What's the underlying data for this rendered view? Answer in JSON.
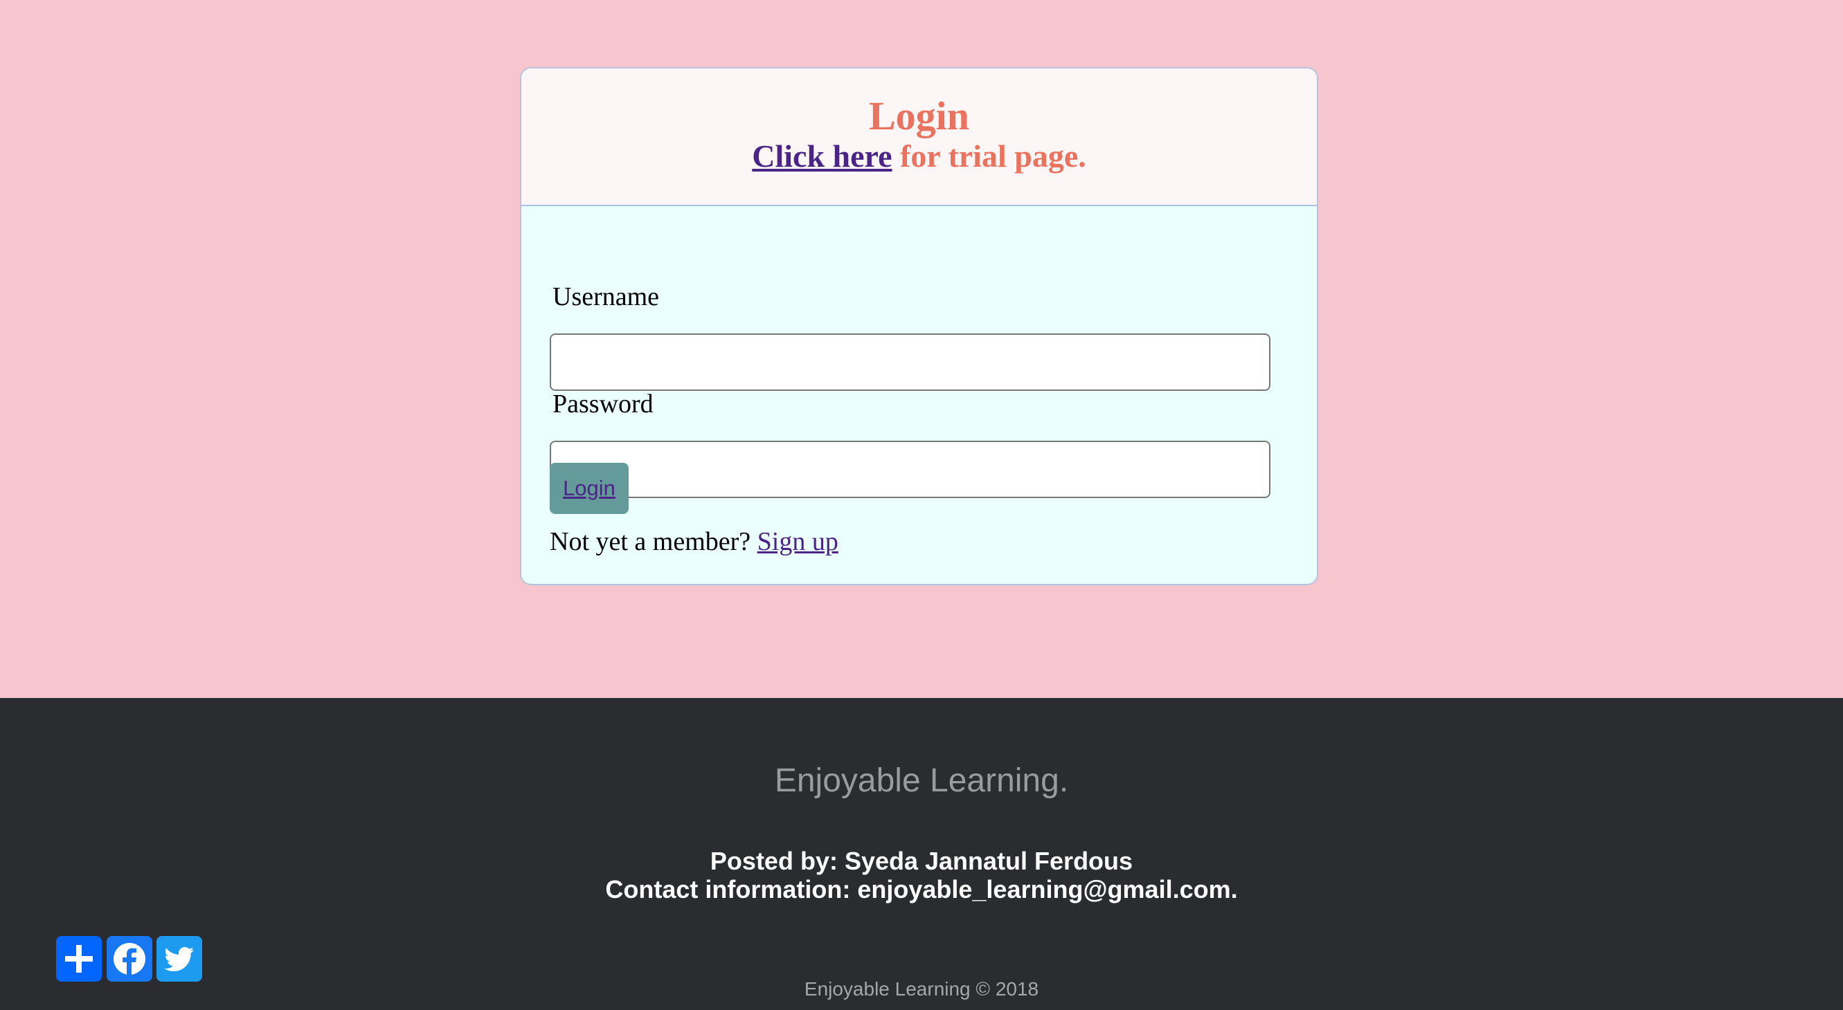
{
  "login_card": {
    "title": "Login",
    "subtitle_link": "Click here",
    "subtitle_rest": " for trial page.",
    "username_label": "Username",
    "username_value": "",
    "password_label": "Password",
    "password_value": "",
    "login_button": "Login",
    "signup_prompt": "Not yet a member? ",
    "signup_link": "Sign up"
  },
  "footer": {
    "tagline": "Enjoyable Learning.",
    "posted_by": "Posted by: Syeda Jannatul Ferdous",
    "contact": "Contact information: enjoyable_learning@gmail.com.",
    "copyright": "Enjoyable Learning © 2018"
  },
  "share": {
    "icons": [
      "plus-icon",
      "facebook-icon",
      "twitter-icon"
    ]
  },
  "colors": {
    "page_background": "#f7c5ce",
    "card_header": "#fdf6f6",
    "card_body": "#ebffff",
    "title": "#e9735e",
    "link": "#4a2487",
    "button": "#659a9b",
    "footer": "#2b2c30"
  }
}
